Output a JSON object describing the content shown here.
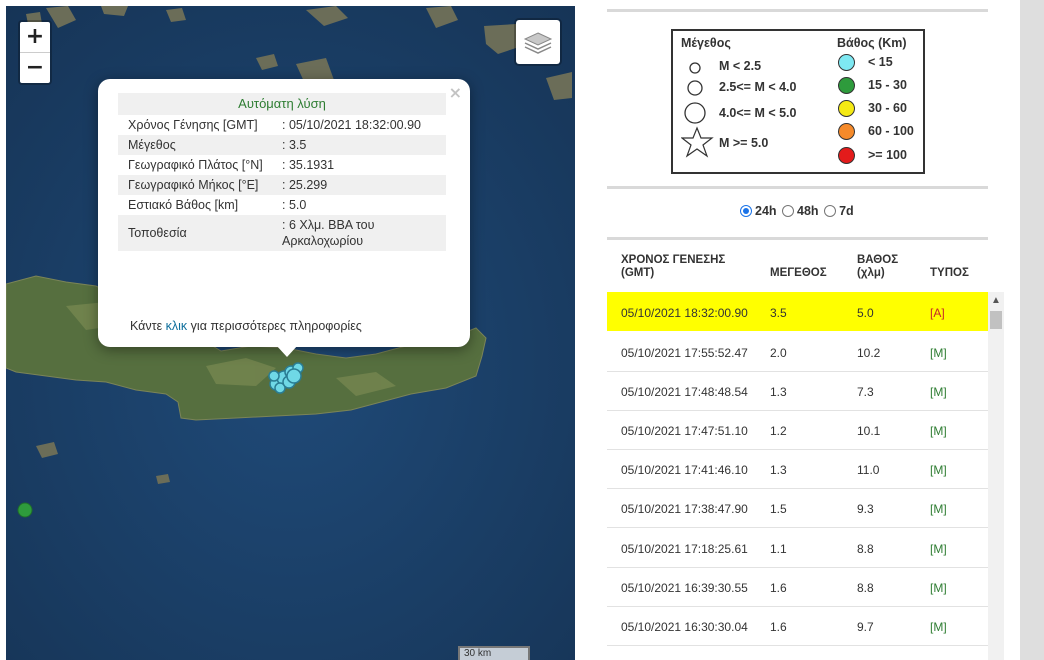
{
  "map": {
    "zoom_in": "+",
    "zoom_out": "−",
    "layers_icon": "layers-icon",
    "scale_label": "30 km",
    "popup": {
      "title": "Αυτόματη λύση",
      "close": "×",
      "rows": [
        {
          "key": "Χρόνος Γένησης [GMT]",
          "value": ": 05/10/2021 18:32:00.90"
        },
        {
          "key": "Μέγεθος",
          "value": ": 3.5"
        },
        {
          "key": "Γεωγραφικό Πλάτος [°N]",
          "value": ": 35.1931"
        },
        {
          "key": "Γεωγραφικό Μήκος [°E]",
          "value": ": 25.299"
        },
        {
          "key": "Εστιακό Βάθος [km]",
          "value": ": 5.0"
        },
        {
          "key": "Τοποθεσία",
          "value": ": 6 Χλμ. ΒΒΑ του Αρκαλοχωρίου"
        }
      ],
      "footer_pre": "Κάντε",
      "footer_link": "κλικ",
      "footer_post": "για περισσότερες πληροφορίες"
    }
  },
  "legend": {
    "size_title": "Μέγεθος",
    "depth_title": "Βάθος (Km)",
    "sizes": [
      "M < 2.5",
      "2.5<= M < 4.0",
      "4.0<= M < 5.0",
      "M >= 5.0"
    ],
    "depths": [
      {
        "label": "< 15",
        "color": "#7ee8f2"
      },
      {
        "label": "15 - 30",
        "color": "#2e9b3c"
      },
      {
        "label": "30 - 60",
        "color": "#f5ea14"
      },
      {
        "label": "60 - 100",
        "color": "#f58a2a"
      },
      {
        "label": ">= 100",
        "color": "#e31b1b"
      }
    ]
  },
  "filters": {
    "options": [
      "24h",
      "48h",
      "7d"
    ],
    "selected": "24h"
  },
  "table": {
    "headers": {
      "time": "ΧΡΟΝΟΣ ΓΕΝΕΣΗΣ (GMT)",
      "mag": "ΜΕΓΕΘΟΣ",
      "depth": "ΒΑΘΟΣ (χλμ)",
      "type": "ΤΥΠΟΣ"
    },
    "rows": [
      {
        "time": "05/10/2021 18:32:00.90",
        "mag": "3.5",
        "depth": "5.0",
        "type": "[A]"
      },
      {
        "time": "05/10/2021 17:55:52.47",
        "mag": "2.0",
        "depth": "10.2",
        "type": "[M]"
      },
      {
        "time": "05/10/2021 17:48:48.54",
        "mag": "1.3",
        "depth": "7.3",
        "type": "[M]"
      },
      {
        "time": "05/10/2021 17:47:51.10",
        "mag": "1.2",
        "depth": "10.1",
        "type": "[M]"
      },
      {
        "time": "05/10/2021 17:41:46.10",
        "mag": "1.3",
        "depth": "11.0",
        "type": "[M]"
      },
      {
        "time": "05/10/2021 17:38:47.90",
        "mag": "1.5",
        "depth": "9.3",
        "type": "[M]"
      },
      {
        "time": "05/10/2021 17:18:25.61",
        "mag": "1.1",
        "depth": "8.8",
        "type": "[M]"
      },
      {
        "time": "05/10/2021 16:39:30.55",
        "mag": "1.6",
        "depth": "8.8",
        "type": "[M]"
      },
      {
        "time": "05/10/2021 16:30:30.04",
        "mag": "1.6",
        "depth": "9.7",
        "type": "[M]"
      }
    ]
  },
  "colors": {
    "selected_row": "#ffff00",
    "manual_type": "#2e7d32",
    "automatic_type": "#c62828",
    "sea": "#1d3f66",
    "land": "#4f6a3a"
  }
}
